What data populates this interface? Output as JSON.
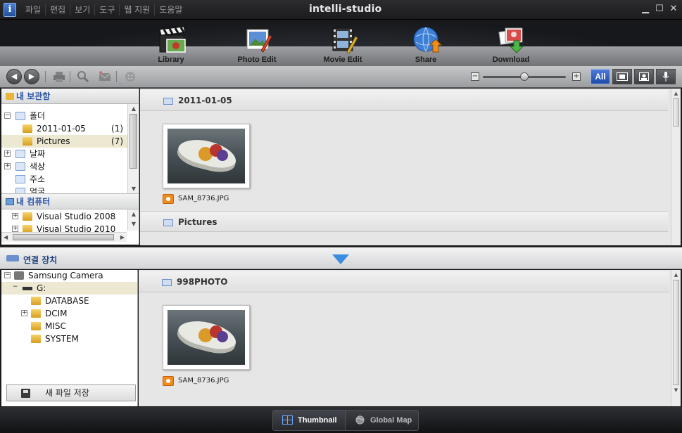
{
  "menu": [
    "파일",
    "편집",
    "보기",
    "도구",
    "웹 지원",
    "도움말"
  ],
  "app_title": "intelli-studio",
  "window_controls": {
    "minimize": "▁",
    "maximize": "☐",
    "close": "✕"
  },
  "nav": [
    {
      "label": "Library",
      "icon": "clapperboard-icon"
    },
    {
      "label": "Photo Edit",
      "icon": "photo-edit-icon"
    },
    {
      "label": "Movie Edit",
      "icon": "movie-edit-icon"
    },
    {
      "label": "Share",
      "icon": "globe-share-icon"
    },
    {
      "label": "Download",
      "icon": "download-icon"
    }
  ],
  "toolbar": {
    "back": "◀",
    "forward": "▶",
    "zoom_out": "−",
    "zoom_in": "+",
    "filter_all": "All",
    "zoom_level": 0.5
  },
  "library": {
    "header": "내 보관함",
    "tree": [
      {
        "label": "폴더",
        "expander": "−",
        "count": ""
      },
      {
        "label": "2011-01-05",
        "expander": "",
        "count": "(1)"
      },
      {
        "label": "Pictures",
        "expander": "",
        "count": "(7)"
      },
      {
        "label": "날짜",
        "expander": "+",
        "count": ""
      },
      {
        "label": "색상",
        "expander": "+",
        "count": ""
      },
      {
        "label": "주소",
        "expander": "",
        "count": ""
      },
      {
        "label": "얼굴",
        "expander": "",
        "count": ""
      }
    ]
  },
  "computer": {
    "header": "내 컴퓨터",
    "tree": [
      {
        "label": "Visual Studio 2008",
        "expander": "+"
      },
      {
        "label": "Visual Studio 2010",
        "expander": "+"
      }
    ]
  },
  "content_top": {
    "groups": [
      {
        "title": "2011-01-05",
        "files": [
          "SAM_8736.JPG"
        ]
      },
      {
        "title": "Pictures"
      }
    ]
  },
  "devices": {
    "header": "연결 장치",
    "tree": [
      {
        "label": "Samsung Camera",
        "expander": "−"
      },
      {
        "label": "G:",
        "expander": "−"
      },
      {
        "label": "DATABASE",
        "expander": ""
      },
      {
        "label": "DCIM",
        "expander": "+"
      },
      {
        "label": "MISC",
        "expander": ""
      },
      {
        "label": "SYSTEM",
        "expander": ""
      }
    ],
    "save_button": "새 파일 저장"
  },
  "content_bottom": {
    "group_title": "998PHOTO",
    "files": [
      "SAM_8736.JPG"
    ]
  },
  "view_tabs": [
    {
      "label": "Thumbnail",
      "active": true
    },
    {
      "label": "Global Map",
      "active": false
    }
  ],
  "colors": {
    "accent": "#2a5bc0",
    "folder": "#e9b43a",
    "camera_badge": "#f28b1e"
  }
}
